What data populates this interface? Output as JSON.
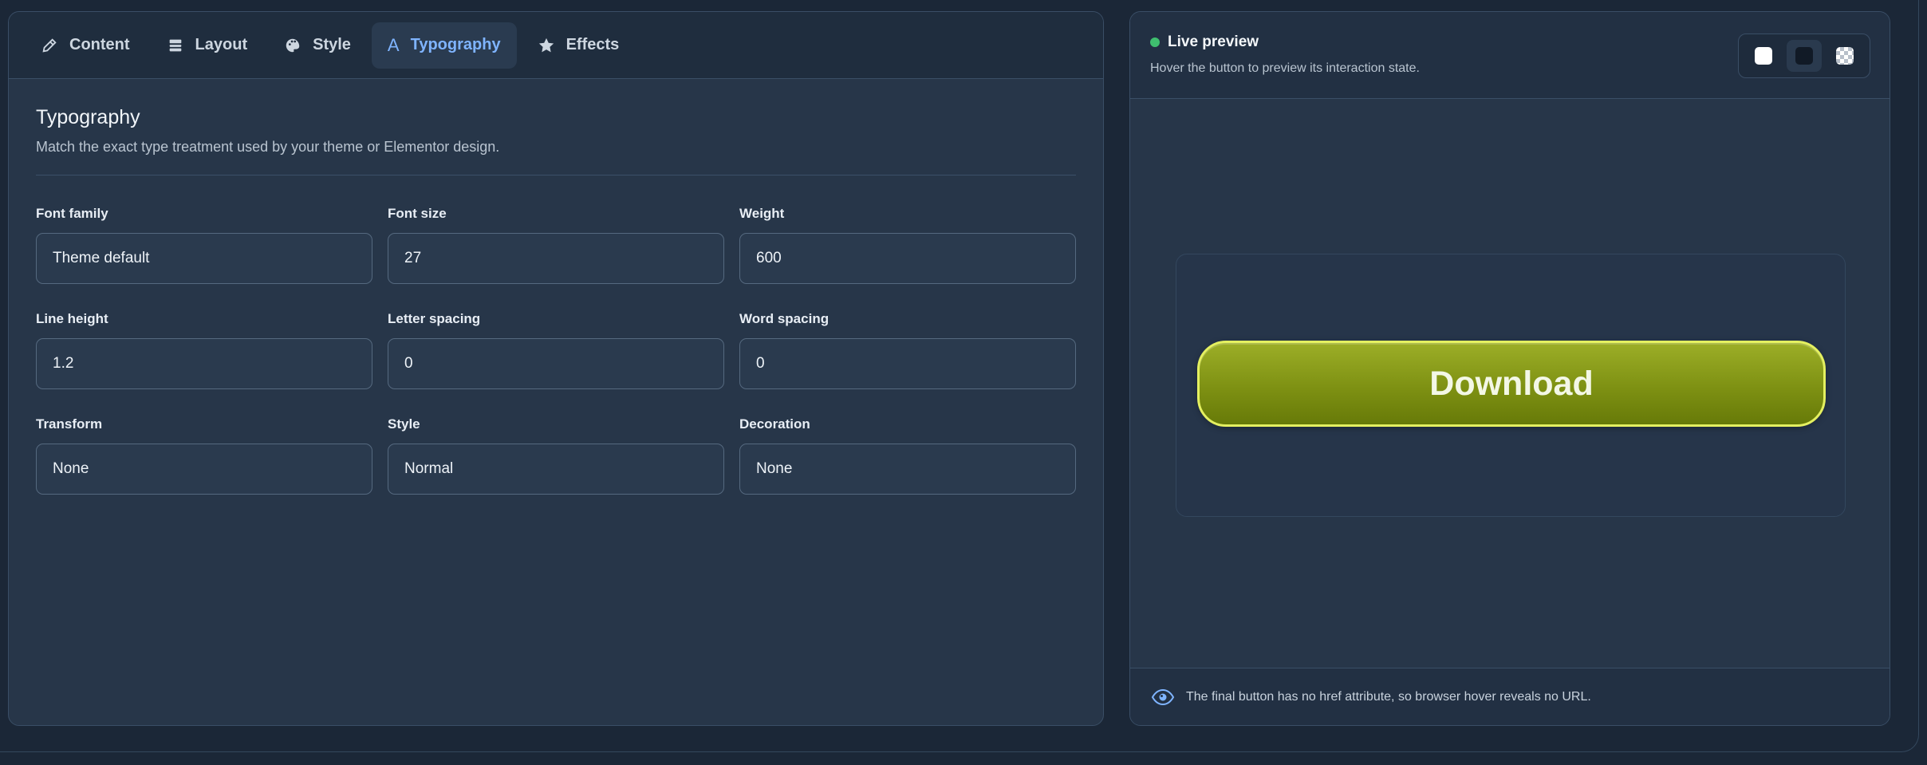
{
  "tabs": [
    {
      "label": "Content",
      "icon": "pencil-icon"
    },
    {
      "label": "Layout",
      "icon": "layout-icon"
    },
    {
      "label": "Style",
      "icon": "palette-icon"
    },
    {
      "label": "Typography",
      "icon": "typography-icon",
      "glyph": "A",
      "active": true
    },
    {
      "label": "Effects",
      "icon": "star-icon"
    }
  ],
  "typography": {
    "title": "Typography",
    "description": "Match the exact type treatment used by your theme or Elementor design.",
    "fields": [
      {
        "label": "Font family",
        "value": "Theme default"
      },
      {
        "label": "Font size",
        "value": "27"
      },
      {
        "label": "Weight",
        "value": "600"
      },
      {
        "label": "Line height",
        "value": "1.2"
      },
      {
        "label": "Letter spacing",
        "value": "0"
      },
      {
        "label": "Word spacing",
        "value": "0"
      },
      {
        "label": "Transform",
        "value": "None"
      },
      {
        "label": "Style",
        "value": "Normal"
      },
      {
        "label": "Decoration",
        "value": "None"
      }
    ]
  },
  "preview": {
    "title": "Live preview",
    "description": "Hover the button to preview its interaction state.",
    "button_label": "Download",
    "footer_note": "The final button has no href attribute, so browser hover reveals no URL.",
    "colors": {
      "button_top": "#9cae27",
      "button_bottom": "#677a08",
      "button_border": "#e4f060",
      "accent": "#7fb4ff",
      "live_dot": "#3fbf6f"
    }
  }
}
